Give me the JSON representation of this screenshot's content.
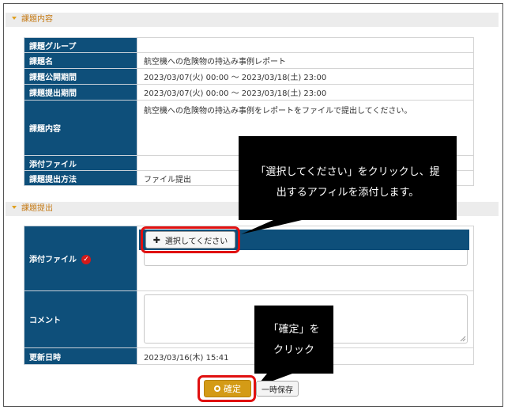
{
  "sections": {
    "content_title": "課題内容",
    "submit_title": "課題提出"
  },
  "assignment": {
    "rows": [
      {
        "label": "課題グループ",
        "value": ""
      },
      {
        "label": "課題名",
        "value": "航空機への危険物の持込み事例レポート"
      },
      {
        "label": "課題公開期間",
        "value": "2023/03/07(火) 00:00 ～ 2023/03/18(土) 23:00"
      },
      {
        "label": "課題提出期間",
        "value": "2023/03/07(火) 00:00 ～ 2023/03/18(土) 23:00"
      },
      {
        "label": "課題内容",
        "value": "航空機への危険物の持込み事例をレポートをファイルで提出してください。"
      },
      {
        "label": "添付ファイル",
        "value": ""
      },
      {
        "label": "課題提出方法",
        "value": "ファイル提出"
      }
    ]
  },
  "submission": {
    "attach_label": "添付ファイル",
    "select_button": "選択してください",
    "comment_label": "コメント",
    "updated_label": "更新日時",
    "updated_value": "2023/03/16(木) 15:41"
  },
  "buttons": {
    "confirm": "確定",
    "temp_save": "一時保存"
  },
  "callouts": {
    "select_line1": "「選択してください」をクリックし、提",
    "select_line2": "出するアフィルを添付します。",
    "confirm_line1": "「確定」を",
    "confirm_line2": "クリック"
  },
  "colors": {
    "header_blue": "#0e4f7a",
    "confirm_gold": "#d49b16",
    "highlight_red": "#e01010",
    "section_orange": "#c57a15"
  }
}
